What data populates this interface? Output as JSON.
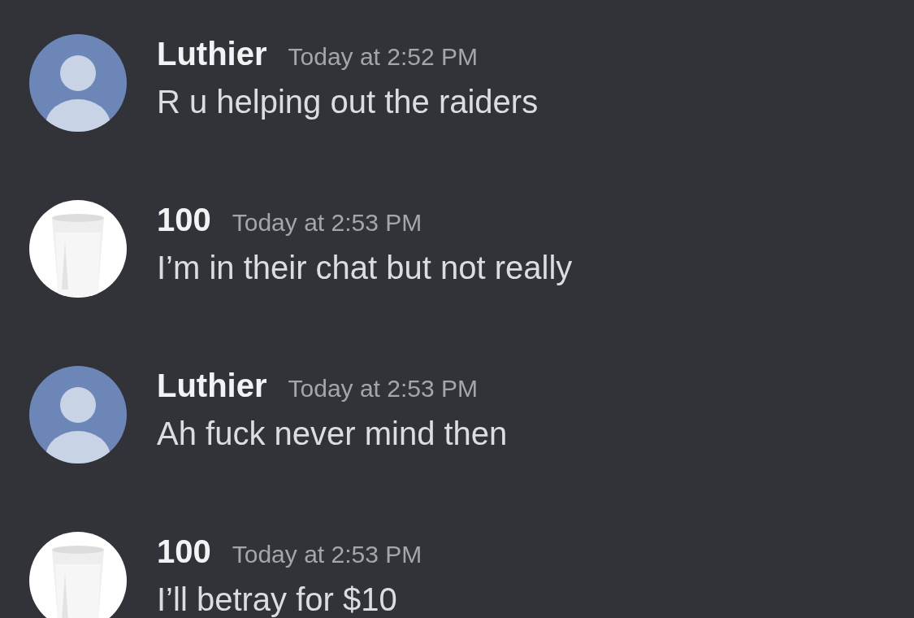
{
  "messages": [
    {
      "author": "Luthier",
      "time": "Today at 2:52 PM",
      "text": "R u helping out the raiders",
      "avatar": {
        "kind": "silhouette"
      }
    },
    {
      "author": "100",
      "time": "Today at 2:53 PM",
      "text": "I’m in their chat but not really"
    },
    {
      "author": "Luthier",
      "time": "Today at 2:53 PM",
      "text": "Ah fuck never mind then",
      "avatar": {
        "kind": "silhouette"
      }
    },
    {
      "author": "100",
      "time": "Today at 2:53 PM",
      "text": "I’ll betray for $10"
    }
  ]
}
